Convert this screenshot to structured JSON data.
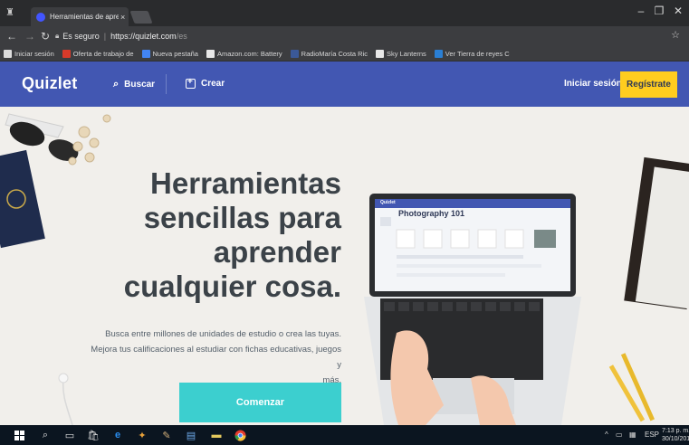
{
  "browser": {
    "tab_title": "Herramientas de aprend",
    "tab_close": "×",
    "secure_label": "Es seguro",
    "url_host": "https://quizlet.com",
    "url_path": "/es",
    "window_controls": [
      "–",
      "❐",
      "✕"
    ],
    "bookmarks": [
      {
        "label": "Iniciar sesión",
        "icon": "page-icon",
        "color": "#dcdcdc"
      },
      {
        "label": "Oferta de trabajo de",
        "icon": "flag-icon",
        "color": "#d83a2a"
      },
      {
        "label": "Nueva pestaña",
        "icon": "google-icon",
        "color": "#4285f4"
      },
      {
        "label": "Amazon.com: Battery",
        "icon": "bookmark-icon",
        "color": "#e8e8e8"
      },
      {
        "label": "RadioMaría Costa Ric",
        "icon": "facebook-icon",
        "color": "#3b5998"
      },
      {
        "label": "Sky Lanterns",
        "icon": "bookmark-icon",
        "color": "#e8e8e8"
      },
      {
        "label": "Ver Tierra de reyes C",
        "icon": "tv-icon",
        "color": "#2a7fd4"
      }
    ]
  },
  "header": {
    "logo": "Quizlet",
    "search_label": "Buscar",
    "create_label": "Crear",
    "login_label": "Iniciar sesión",
    "signup_label": "Regístrate",
    "bg_color": "#4257b2",
    "signup_color": "#ffcd1f"
  },
  "hero": {
    "headline_lines": [
      "Herramientas",
      "sencillas para",
      "aprender",
      "cualquier cosa."
    ],
    "sub_lines": [
      "Busca entre millones de unidades de estudio o crea las tuyas.",
      "Mejora tus calificaciones al estudiar con fichas educativas, juegos y",
      "más."
    ],
    "cta_label": "Comenzar",
    "cta_color": "#3ccfcf",
    "laptop_screen_title": "Photography 101",
    "laptop_screen_brand": "Quizlet"
  },
  "taskbar": {
    "lang": "ESP",
    "time": "7:13 p. m.",
    "date": "30/10/201"
  }
}
